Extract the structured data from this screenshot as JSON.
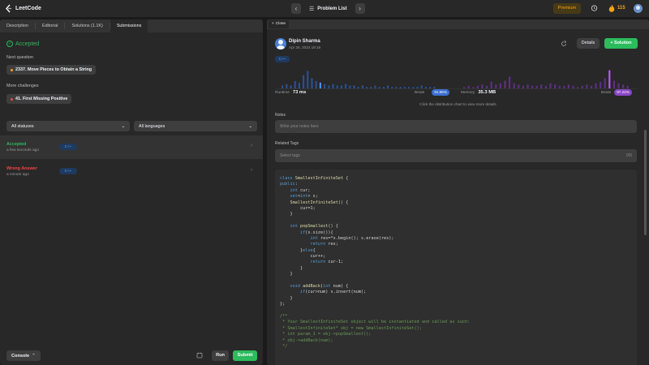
{
  "topbar": {
    "logo_text": "LeetCode",
    "problem_list_label": "Problem List",
    "premium_label": "Premium",
    "streak_count": "115"
  },
  "left": {
    "tabs": [
      "Description",
      "Editorial",
      "Solutions (1.1K)",
      "Submissions"
    ],
    "active_tab": "Submissions",
    "status_title": "Accepted",
    "next_question_label": "Next question",
    "next_question": "2337. Move Pieces to Obtain a String",
    "more_challenges_label": "More challenges",
    "more_challenge": "41. First Missing Positive",
    "filter_status": "All statuses",
    "filter_language": "All languages",
    "submissions": [
      {
        "status": "Accepted",
        "time": "a few seconds ago",
        "language": "C++",
        "color": "#2cbb5d"
      },
      {
        "status": "Wrong Answer",
        "time": "a minute ago",
        "language": "C++",
        "color": "#ef4743"
      }
    ],
    "console_label": "Console",
    "run_label": "Run",
    "submit_label": "Submit"
  },
  "right": {
    "close_label": "Close",
    "author_name": "Dipin Sharma",
    "author_date": "Apr 25, 2023 19:19",
    "details_label": "Details",
    "solution_label": "+ Solution",
    "language": "C++",
    "runtime_label": "Runtime",
    "runtime_value": "73 ms",
    "runtime_beats_label": "Beats",
    "runtime_beats": "91.65%",
    "memory_label": "Memory",
    "memory_value": "35.3 MB",
    "memory_beats_label": "Beats",
    "memory_beats": "97.22%",
    "hint": "Click the distribution chart to view more details",
    "notes_label": "Notes",
    "notes_placeholder": "Write your notes here",
    "tags_label": "Related Tags",
    "tags_placeholder": "Select tags",
    "tags_count": "0/5",
    "code": [
      "class SmallestInfiniteSet {",
      "public:",
      "    int cur;",
      "    set<int> s;",
      "    SmallestInfiniteSet() {",
      "        cur=1;",
      "    }",
      "",
      "    int popSmallest() {",
      "        if(s.size()){",
      "            int res=*s.begin(); s.erase(res);",
      "            return res;",
      "        }else{",
      "            cur++;",
      "            return cur-1;",
      "        }",
      "    }",
      "",
      "    void addBack(int num) {",
      "        if(cur>num) s.insert(num);",
      "    }",
      "};",
      "",
      "/**",
      " * Your SmallestInfiniteSet object will be instantiated and called as such:",
      " * SmallestInfiniteSet* obj = new SmallestInfiniteSet();",
      " * int param_1 = obj->popSmallest();",
      " * obj->addBack(num);",
      " */"
    ]
  },
  "colors": {
    "accent_green": "#2cbb5d",
    "error_red": "#ef4743",
    "brand_orange": "#ffa116",
    "runtime_blue": "#3b6fd1",
    "memory_purple": "#8b46c6"
  },
  "icons": [
    "leetcode-logo-icon",
    "chevron-left-icon",
    "chevron-right-icon",
    "list-icon",
    "alarm-icon",
    "flame-icon",
    "check-circle-icon",
    "chevron-down-icon",
    "chevron-right-icon",
    "close-icon",
    "share-icon",
    "notes-icon"
  ]
}
